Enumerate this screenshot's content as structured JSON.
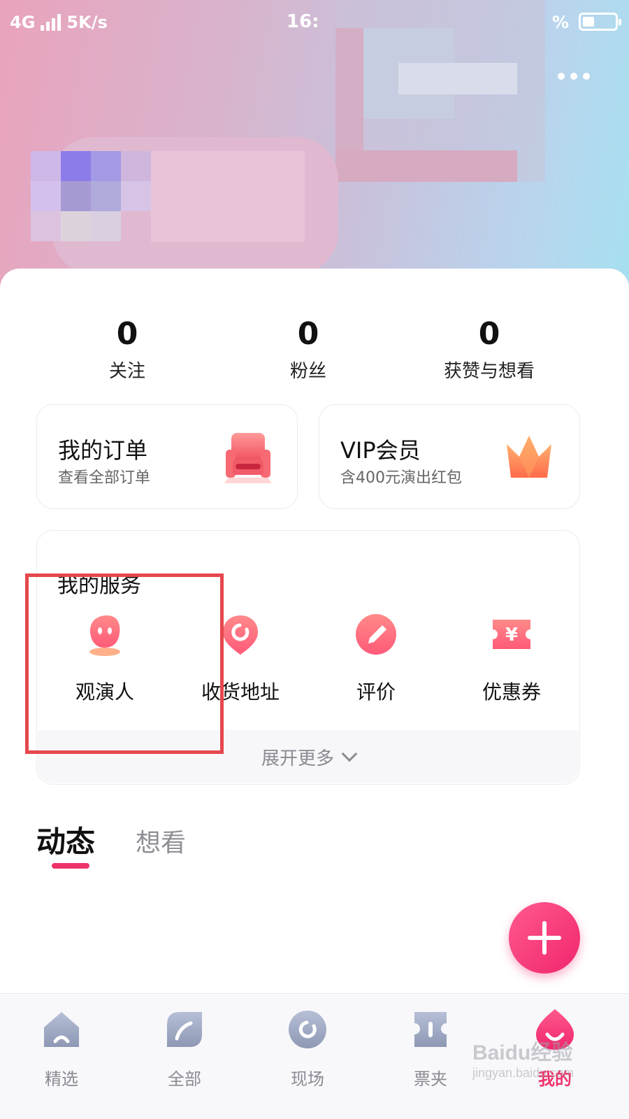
{
  "status_bar": {
    "network": "4G",
    "speed": "5K/s",
    "time": "16:",
    "battery_pct": "%"
  },
  "stats": [
    {
      "value": "0",
      "label": "关注"
    },
    {
      "value": "0",
      "label": "粉丝"
    },
    {
      "value": "0",
      "label": "获赞与想看"
    }
  ],
  "order_card": {
    "title": "我的订单",
    "subtitle": "查看全部订单",
    "icon": "seat-icon"
  },
  "vip_card": {
    "title": "VIP会员",
    "subtitle": "含400元演出红包",
    "icon": "crown-icon"
  },
  "services": {
    "title": "我的服务",
    "items": [
      {
        "label": "观演人",
        "icon": "audience-person-icon"
      },
      {
        "label": "收货地址",
        "icon": "location-icon"
      },
      {
        "label": "评价",
        "icon": "pen-icon"
      },
      {
        "label": "优惠券",
        "icon": "coupon-icon"
      }
    ],
    "expand_label": "展开更多"
  },
  "tabs": [
    {
      "label": "动态",
      "active": true
    },
    {
      "label": "想看",
      "active": false
    }
  ],
  "bottom_nav": [
    {
      "label": "精选",
      "icon": "home-icon",
      "active": false
    },
    {
      "label": "全部",
      "icon": "category-leaf-icon",
      "active": false
    },
    {
      "label": "现场",
      "icon": "eye-icon",
      "active": false
    },
    {
      "label": "票夹",
      "icon": "ticket-icon",
      "active": false
    },
    {
      "label": "我的",
      "icon": "profile-icon",
      "active": true
    }
  ],
  "watermark": {
    "brand": "Baidu经验",
    "url": "jingyan.baidu.com"
  },
  "colors": {
    "accent": "#f0326a",
    "highlight": "#e5484d",
    "icon_gradient_start": "#ff8a8a",
    "icon_gradient_end": "#ff5a78"
  }
}
